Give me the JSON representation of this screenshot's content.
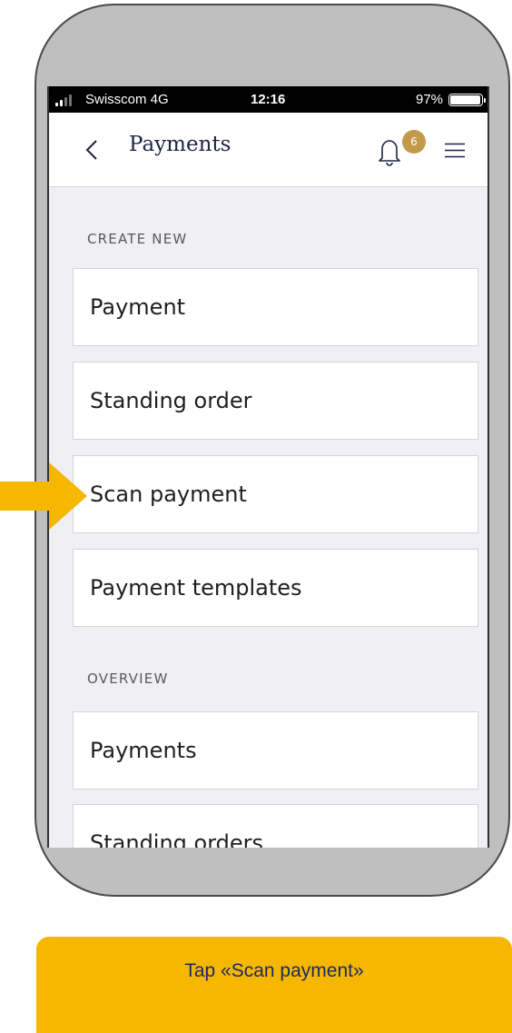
{
  "status_bar": {
    "carrier": "Swisscom  4G",
    "time": "12:16",
    "battery": "97%",
    "battery_level": 0.97
  },
  "nav": {
    "back_icon": "chevron-left-icon",
    "title": "Payments",
    "notification_count": "6",
    "bell_icon": "bell-icon",
    "menu_icon": "hamburger-menu-icon"
  },
  "sections": {
    "create_new": "CREATE NEW",
    "overview": "OVERVIEW"
  },
  "create_items": [
    {
      "label": "Payment"
    },
    {
      "label": "Standing order"
    },
    {
      "label": "Scan payment"
    },
    {
      "label": "Payment templates"
    }
  ],
  "overview_items": [
    {
      "label": "Payments"
    },
    {
      "label": "Standing orders"
    }
  ],
  "caption": "Tap «Scan payment»",
  "colors": {
    "accent": "#f5b700",
    "badge": "#c39a4a",
    "title": "#1c2444",
    "caption_text": "#1b2a66"
  }
}
